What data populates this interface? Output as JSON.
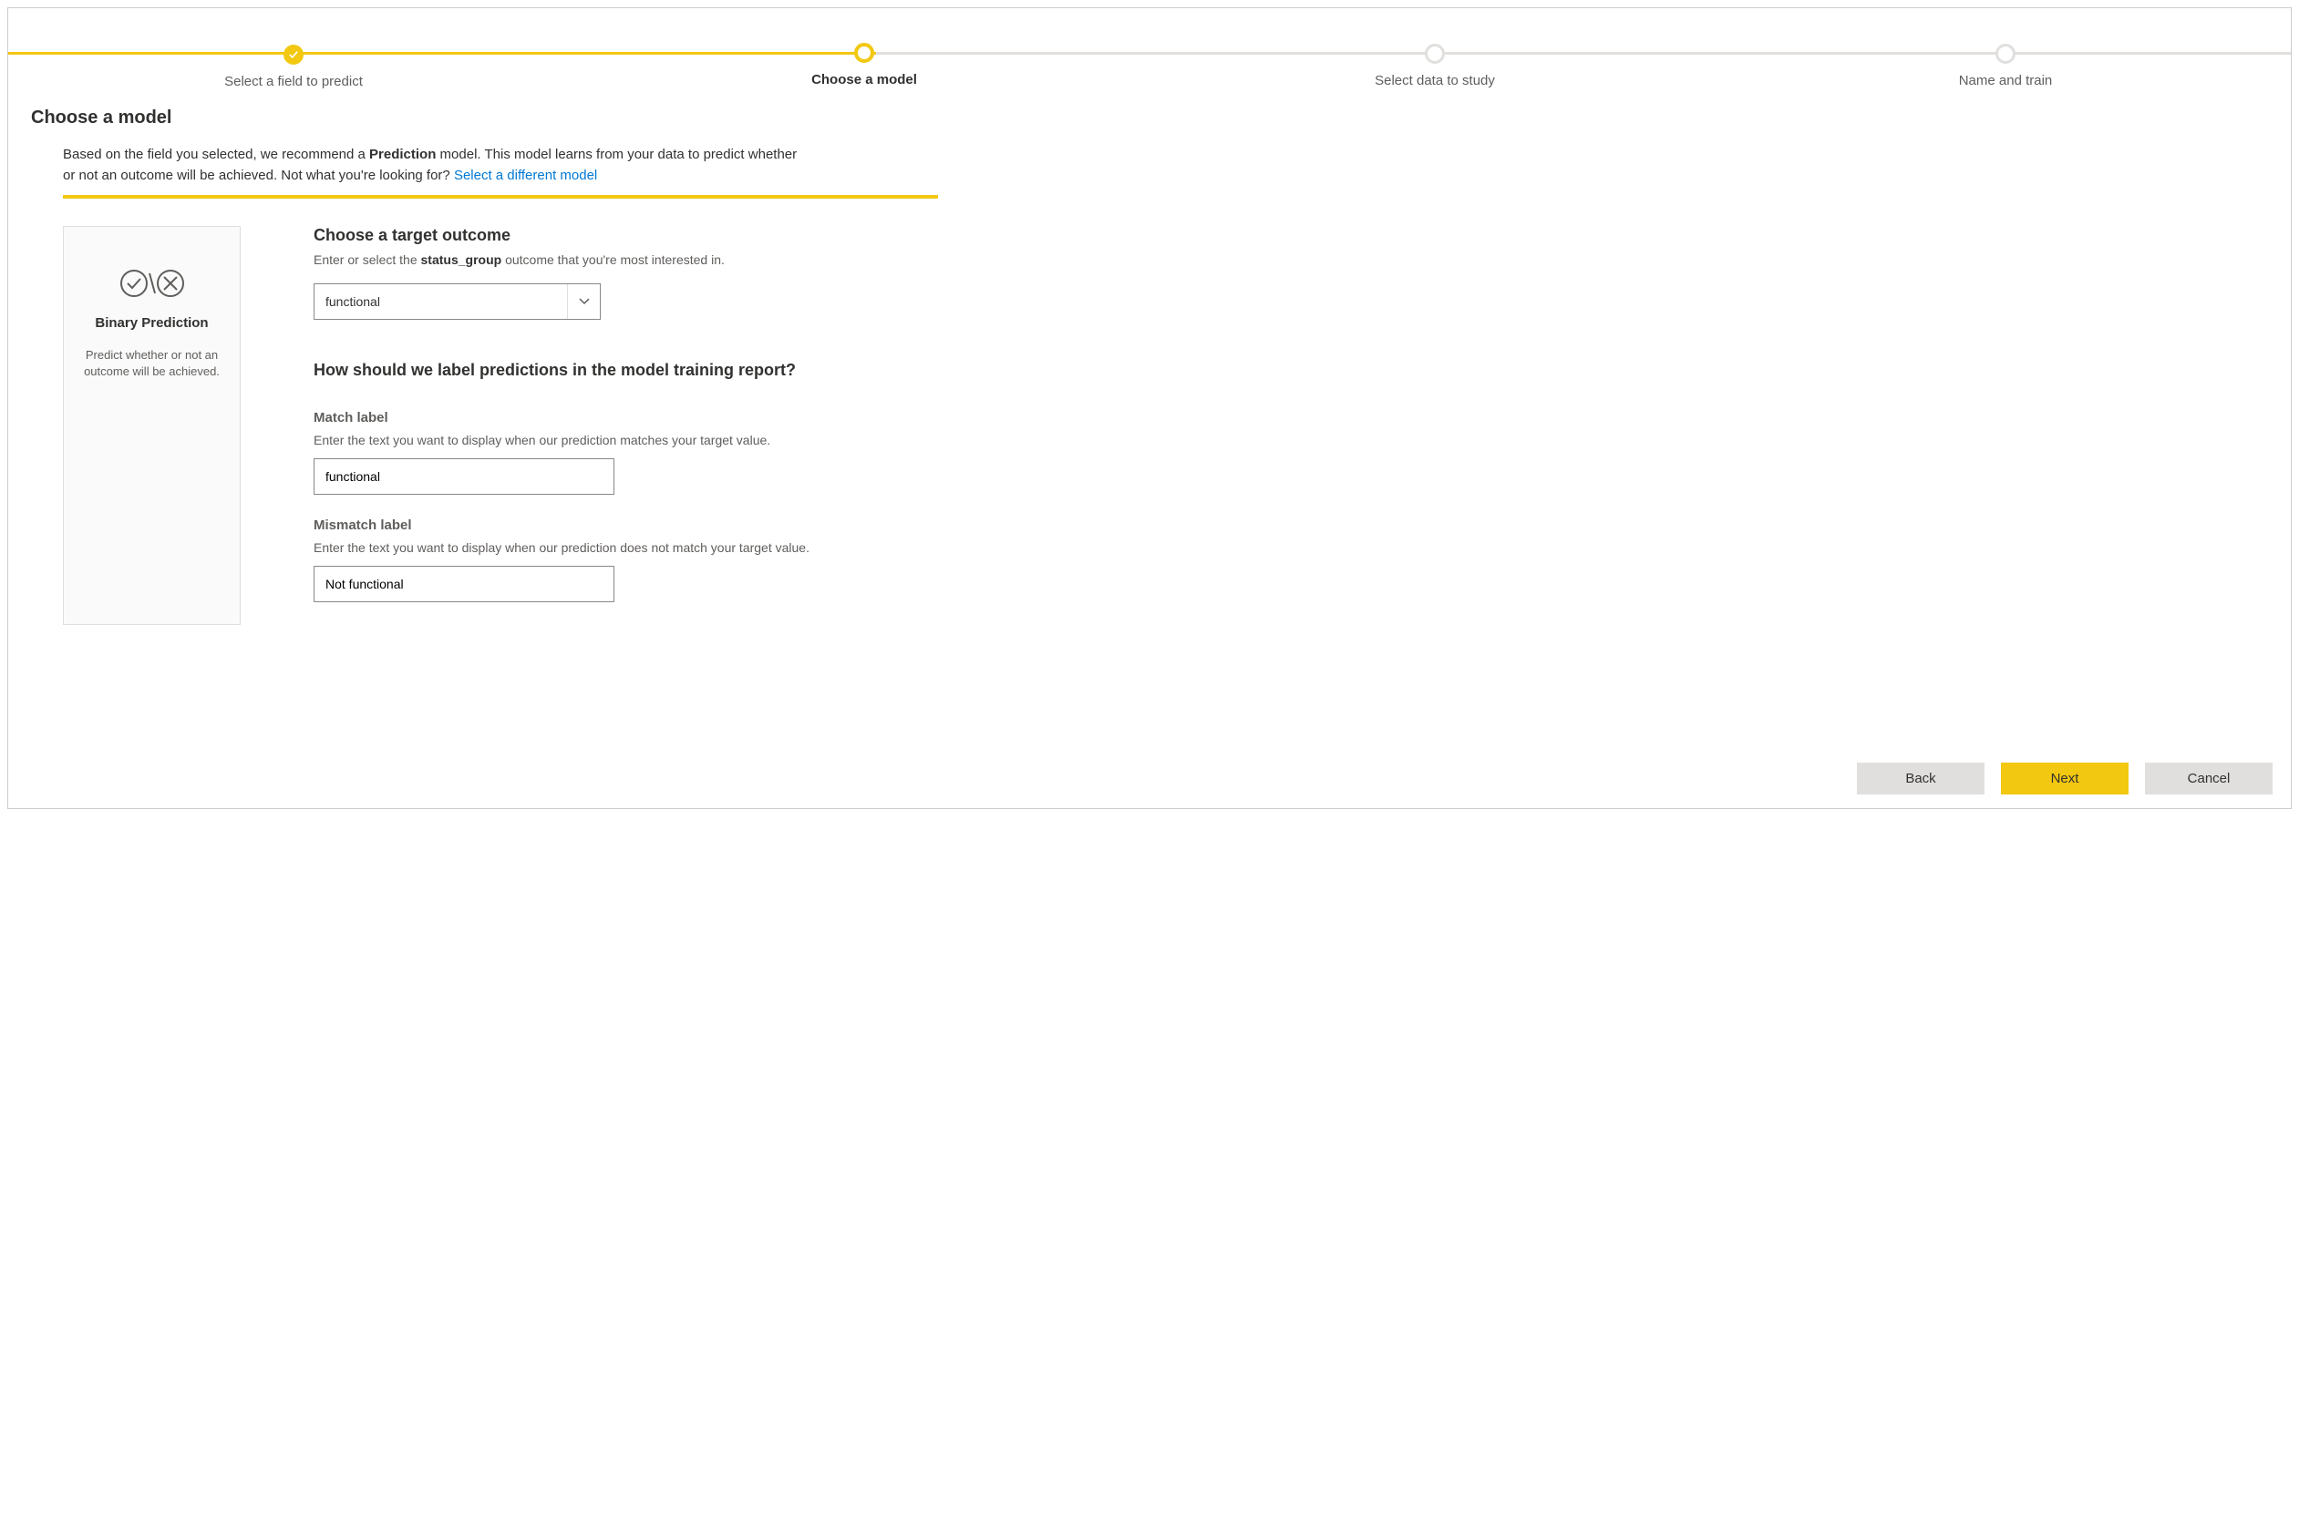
{
  "stepper": {
    "steps": [
      {
        "label": "Select a field to predict",
        "state": "completed"
      },
      {
        "label": "Choose a model",
        "state": "current"
      },
      {
        "label": "Select data to study",
        "state": "pending"
      },
      {
        "label": "Name and train",
        "state": "pending"
      }
    ]
  },
  "page_title": "Choose a model",
  "intro": {
    "prefix": "Based on the field you selected, we recommend a ",
    "bold": "Prediction",
    "middle": " model. This model learns from your data to predict whether or not an outcome will be achieved. Not what you're looking for? ",
    "link": "Select a different model"
  },
  "model_card": {
    "title": "Binary Prediction",
    "desc": "Predict whether or not an outcome will be achieved."
  },
  "target_outcome": {
    "title": "Choose a target outcome",
    "desc_prefix": "Enter or select the ",
    "desc_bold": "status_group",
    "desc_suffix": " outcome that you're most interested in.",
    "value": "functional"
  },
  "label_section": {
    "title": "How should we label predictions in the model training report?",
    "match": {
      "label": "Match label",
      "desc": "Enter the text you want to display when our prediction matches your target value.",
      "value": "functional"
    },
    "mismatch": {
      "label": "Mismatch label",
      "desc": "Enter the text you want to display when our prediction does not match your target value.",
      "value": "Not functional"
    }
  },
  "footer": {
    "back": "Back",
    "next": "Next",
    "cancel": "Cancel"
  }
}
